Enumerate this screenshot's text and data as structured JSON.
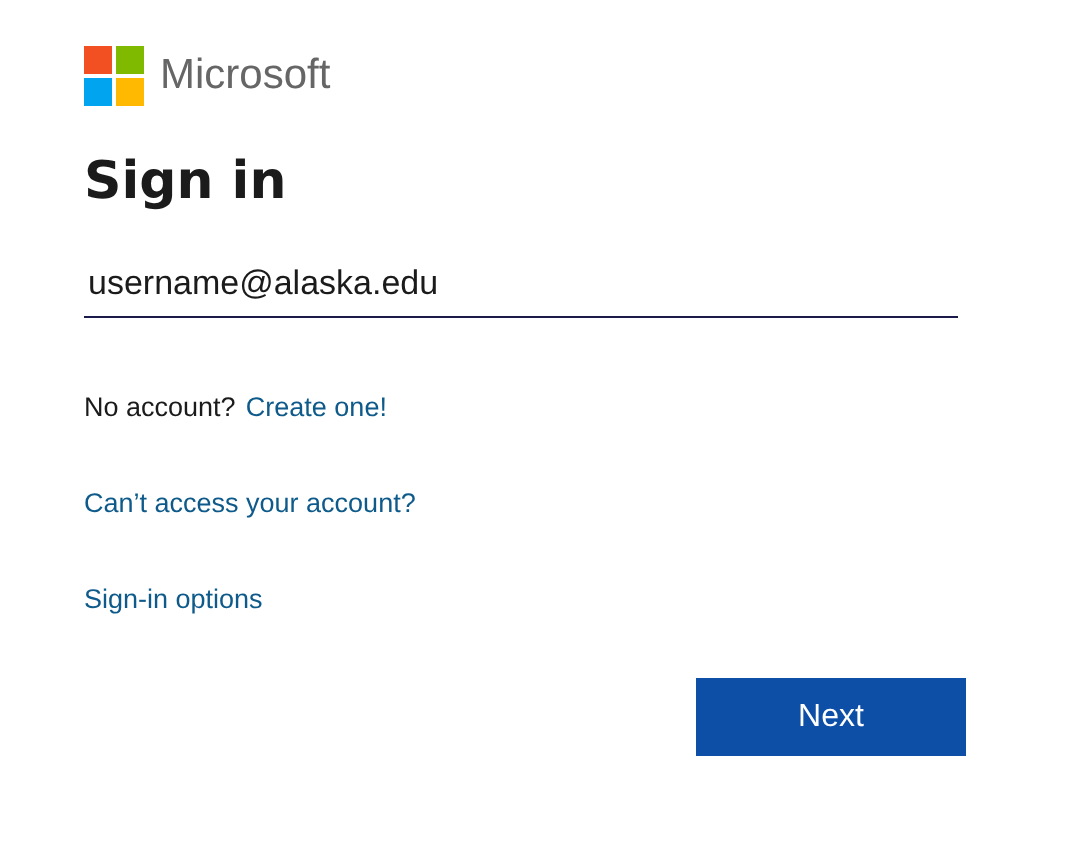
{
  "brand": "Microsoft",
  "title": "Sign in",
  "email_field": {
    "value": "username@alaska.edu",
    "focused": true
  },
  "no_account": {
    "text": "No account?",
    "link": "Create one!"
  },
  "links": [
    "Can’t access your account?",
    "Sign-in options"
  ],
  "buttons": [
    "Next"
  ]
}
